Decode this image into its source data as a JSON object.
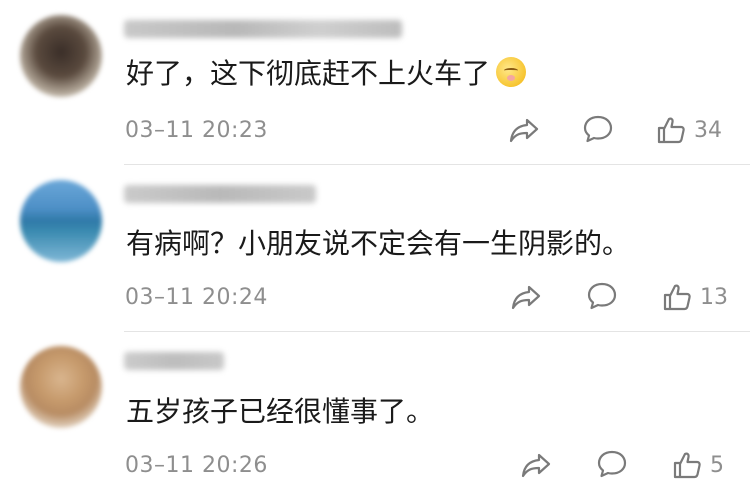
{
  "comments": [
    {
      "text": "好了，这下彻底赶不上火车了",
      "emoji": "shushing-face",
      "time": "03–11 20:23",
      "likes": "34"
    },
    {
      "text": "有病啊？小朋友说不定会有一生阴影的。",
      "time": "03–11 20:24",
      "likes": "13"
    },
    {
      "text": "五岁孩子已经很懂事了。",
      "time": "03–11 20:26",
      "likes": "5"
    }
  ],
  "colors": {
    "meta": "#8e8e8e",
    "text": "#1a1a1a",
    "divider": "#e4e4e4"
  }
}
